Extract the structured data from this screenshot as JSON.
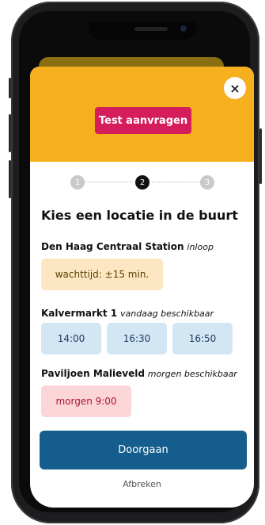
{
  "modal": {
    "test_button_label": "Test aanvragen",
    "close_label": "×"
  },
  "stepper": {
    "steps": [
      "1",
      "2",
      "3"
    ],
    "active_step": 2
  },
  "heading": "Kies een locatie in de buurt",
  "locations": [
    {
      "name": "Den Haag Centraal Station",
      "note": "inloop",
      "pill_type": "wait",
      "pills": [
        "wachttijd: ±15 min."
      ]
    },
    {
      "name": "Kalvermarkt 1",
      "note": "vandaag beschikbaar",
      "pill_type": "time",
      "pills": [
        "14:00",
        "16:30",
        "16:50"
      ]
    },
    {
      "name": "Paviljoen Malieveld",
      "note": "morgen beschikbaar",
      "pill_type": "tomorrow",
      "pills": [
        "morgen 9:00"
      ]
    }
  ],
  "actions": {
    "primary_label": "Doorgaan",
    "cancel_label": "Afbreken"
  },
  "colors": {
    "header": "#f6b01d",
    "test_button": "#d41d5a",
    "primary_button": "#155d8c",
    "wait_pill": "#fde7c2",
    "time_pill": "#d2e6f4",
    "tomorrow_pill": "#fbd5d8"
  }
}
